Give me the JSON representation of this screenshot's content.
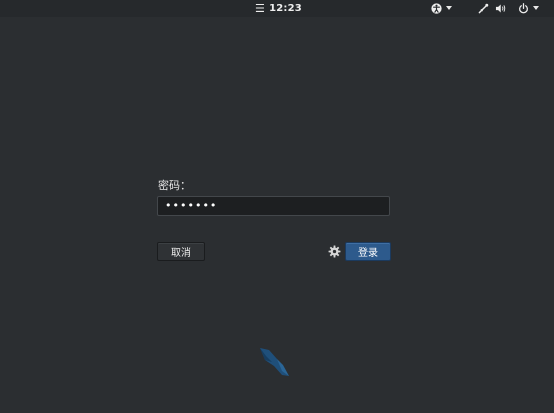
{
  "topbar": {
    "activities_glyph": "☰",
    "clock": "12:23",
    "icons": [
      "accessibility-icon",
      "network-icon",
      "volume-icon",
      "power-icon"
    ]
  },
  "login": {
    "password_label": "密码：",
    "password_value": "•••••••",
    "cancel_label": "取消",
    "login_label": "登录"
  },
  "colors": {
    "background": "#2b2e31",
    "topbar": "#26292c",
    "accent": "#2d5a8c",
    "field": "#1d1f21",
    "logo": "#1f4f7a"
  }
}
